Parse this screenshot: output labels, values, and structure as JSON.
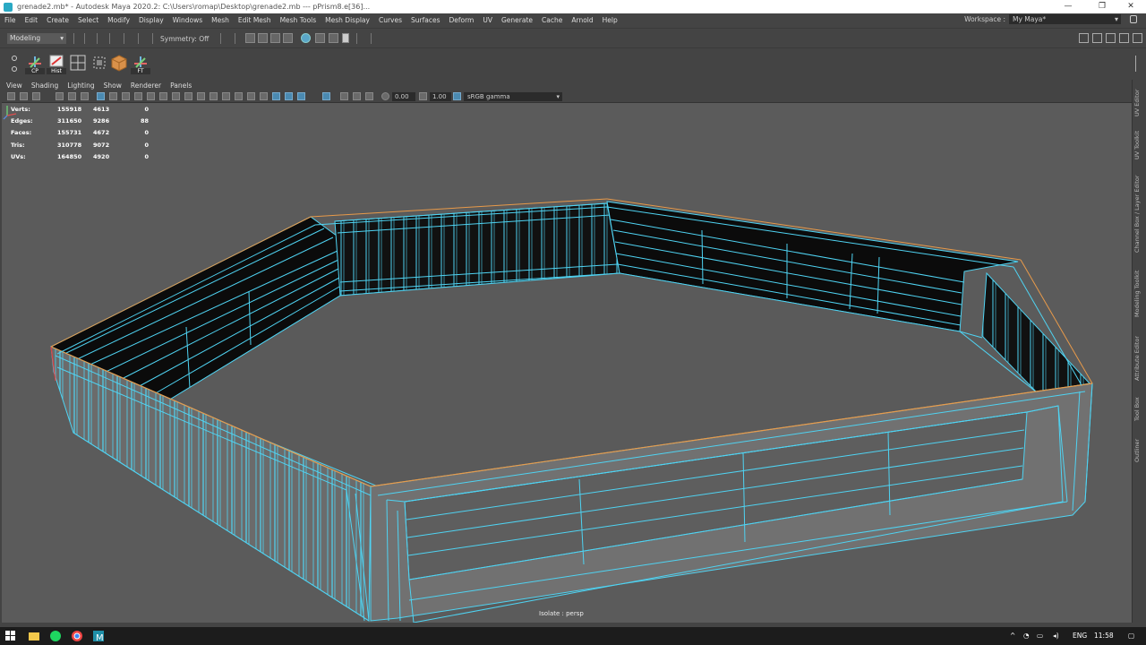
{
  "window": {
    "title": "grenade2.mb* - Autodesk Maya 2020.2: C:\\Users\\romap\\Desktop\\grenade2.mb  ---  pPrism8.e[36]...",
    "minimize": "—",
    "maximize": "❐",
    "close": "✕"
  },
  "menu": [
    "File",
    "Edit",
    "Create",
    "Select",
    "Modify",
    "Display",
    "Windows",
    "Mesh",
    "Edit Mesh",
    "Mesh Tools",
    "Mesh Display",
    "Curves",
    "Surfaces",
    "Deform",
    "UV",
    "Generate",
    "Cache",
    "Arnold",
    "Help"
  ],
  "workspace": {
    "label": "Workspace :",
    "value": "My Maya*"
  },
  "status": {
    "mode": "Modeling",
    "symmetry": "Symmetry: Off"
  },
  "shelf": [
    {
      "label": "CP",
      "icon": "poly-cylinder-icon",
      "color": "#6fb7e0"
    },
    {
      "label": "Hist",
      "icon": "history-icon",
      "color": "#dddddd"
    },
    {
      "label": "",
      "icon": "grid-icon",
      "color": "#cfcfcf"
    },
    {
      "label": "",
      "icon": "box-select-icon",
      "color": "#cfcfcf"
    },
    {
      "label": "",
      "icon": "uv-box-icon",
      "color": "#d9914a"
    },
    {
      "label": "FT",
      "icon": "freeze-transform-icon",
      "color": "#6fb7e0"
    }
  ],
  "panel_menu": [
    "View",
    "Shading",
    "Lighting",
    "Show",
    "Renderer",
    "Panels"
  ],
  "panel_toolbar": {
    "exposure": "0.00",
    "gamma": "1.00",
    "color_space": "sRGB gamma"
  },
  "hud": {
    "rows": [
      {
        "label": "Verts:",
        "v1": "155918",
        "v2": "4613",
        "v3": "0"
      },
      {
        "label": "Edges:",
        "v1": "311650",
        "v2": "9286",
        "v3": "88"
      },
      {
        "label": "Faces:",
        "v1": "155731",
        "v2": "4672",
        "v3": "0"
      },
      {
        "label": "Tris:",
        "v1": "310778",
        "v2": "9072",
        "v3": "0"
      },
      {
        "label": "UVs:",
        "v1": "164850",
        "v2": "4920",
        "v3": "0"
      }
    ]
  },
  "camera_label": "Isolate : persp",
  "side_tabs": [
    "UV Editor",
    "UV Toolkit",
    "Channel Box / Layer Editor",
    "Modeling Toolkit",
    "Attribute Editor",
    "Tool Box",
    "Outliner"
  ],
  "taskbar": {
    "language": "ENG",
    "time": "11:58"
  },
  "colors": {
    "wire": "#4fd3f2",
    "viewport": "#5b5b5b",
    "edge_highlight": "#e89a4a"
  }
}
